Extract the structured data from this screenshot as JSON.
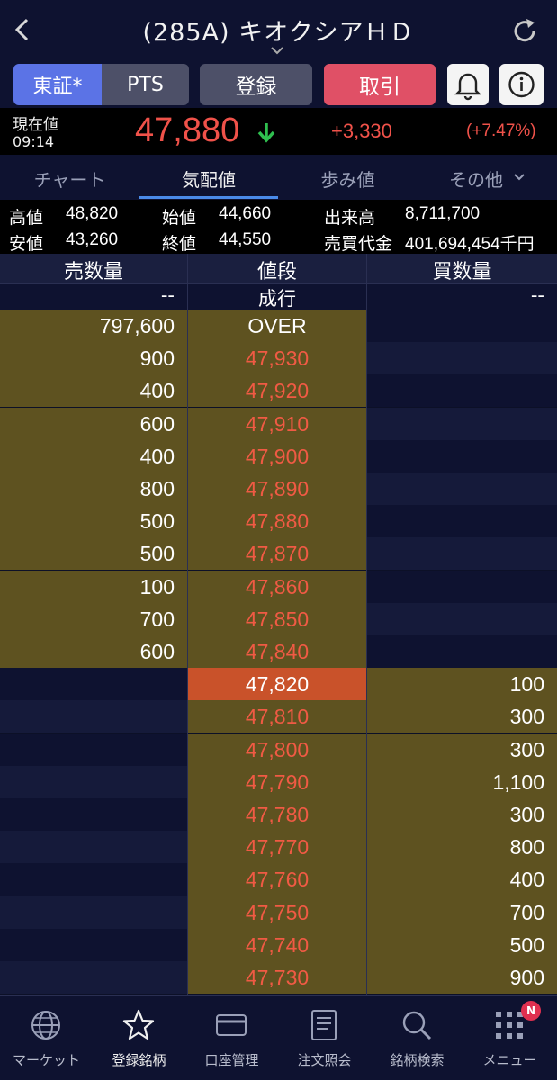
{
  "header": {
    "title": "(285A) キオクシアＨＤ"
  },
  "buttons": {
    "tse": "東証*",
    "pts": "PTS",
    "register": "登録",
    "trade": "取引"
  },
  "quote": {
    "label": "現在値",
    "time": "09:14",
    "price": "47,880",
    "change": "+3,330",
    "change_pct": "(+7.47%)",
    "color_up": "#f0524a",
    "arrow_color": "#2fbf4f"
  },
  "tabs": [
    {
      "label": "チャート"
    },
    {
      "label": "気配値"
    },
    {
      "label": "歩み値"
    },
    {
      "label": "その他"
    }
  ],
  "stats": {
    "high_label": "高値",
    "high": "48,820",
    "open_label": "始値",
    "open": "44,660",
    "volume_label": "出来高",
    "volume": "8,711,700",
    "low_label": "安値",
    "low": "43,260",
    "close_label": "終値",
    "close": "44,550",
    "turnover_label": "売買代金",
    "turnover": "401,694,454千円"
  },
  "board": {
    "sell_header": "売数量",
    "price_header": "値段",
    "buy_header": "買数量",
    "market_sell": "--",
    "market_label": "成行",
    "market_buy": "--",
    "asks": [
      {
        "qty": "797,600",
        "price": "OVER"
      },
      {
        "qty": "900",
        "price": "47,930"
      },
      {
        "qty": "400",
        "price": "47,920"
      },
      {
        "qty": "600",
        "price": "47,910"
      },
      {
        "qty": "400",
        "price": "47,900"
      },
      {
        "qty": "800",
        "price": "47,890"
      },
      {
        "qty": "500",
        "price": "47,880"
      },
      {
        "qty": "500",
        "price": "47,870"
      },
      {
        "qty": "100",
        "price": "47,860"
      },
      {
        "qty": "700",
        "price": "47,850"
      },
      {
        "qty": "600",
        "price": "47,840"
      }
    ],
    "bids": [
      {
        "price": "47,820",
        "qty": "100"
      },
      {
        "price": "47,810",
        "qty": "300"
      },
      {
        "price": "47,800",
        "qty": "300"
      },
      {
        "price": "47,790",
        "qty": "1,100"
      },
      {
        "price": "47,780",
        "qty": "300"
      },
      {
        "price": "47,770",
        "qty": "800"
      },
      {
        "price": "47,760",
        "qty": "400"
      },
      {
        "price": "47,750",
        "qty": "700"
      },
      {
        "price": "47,740",
        "qty": "500"
      },
      {
        "price": "47,730",
        "qty": "900"
      }
    ]
  },
  "nav": [
    {
      "label": "マーケット",
      "icon": "globe-icon"
    },
    {
      "label": "登録銘柄",
      "icon": "star-icon"
    },
    {
      "label": "口座管理",
      "icon": "card-icon"
    },
    {
      "label": "注文照会",
      "icon": "document-icon"
    },
    {
      "label": "銘柄検索",
      "icon": "search-icon"
    },
    {
      "label": "メニュー",
      "icon": "grid-icon"
    }
  ],
  "menu_badge": "N"
}
